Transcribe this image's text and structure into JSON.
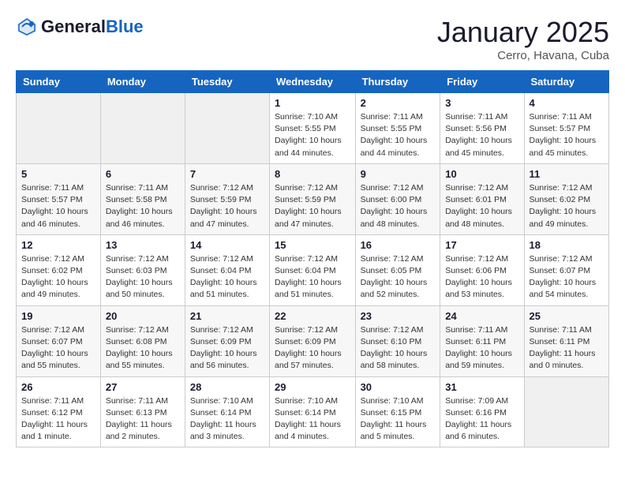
{
  "header": {
    "logo_line1": "General",
    "logo_line2": "Blue",
    "month_title": "January 2025",
    "location": "Cerro, Havana, Cuba"
  },
  "days_of_week": [
    "Sunday",
    "Monday",
    "Tuesday",
    "Wednesday",
    "Thursday",
    "Friday",
    "Saturday"
  ],
  "weeks": [
    [
      {
        "num": "",
        "sunrise": "",
        "sunset": "",
        "daylight": ""
      },
      {
        "num": "",
        "sunrise": "",
        "sunset": "",
        "daylight": ""
      },
      {
        "num": "",
        "sunrise": "",
        "sunset": "",
        "daylight": ""
      },
      {
        "num": "1",
        "sunrise": "Sunrise: 7:10 AM",
        "sunset": "Sunset: 5:55 PM",
        "daylight": "Daylight: 10 hours and 44 minutes."
      },
      {
        "num": "2",
        "sunrise": "Sunrise: 7:11 AM",
        "sunset": "Sunset: 5:55 PM",
        "daylight": "Daylight: 10 hours and 44 minutes."
      },
      {
        "num": "3",
        "sunrise": "Sunrise: 7:11 AM",
        "sunset": "Sunset: 5:56 PM",
        "daylight": "Daylight: 10 hours and 45 minutes."
      },
      {
        "num": "4",
        "sunrise": "Sunrise: 7:11 AM",
        "sunset": "Sunset: 5:57 PM",
        "daylight": "Daylight: 10 hours and 45 minutes."
      }
    ],
    [
      {
        "num": "5",
        "sunrise": "Sunrise: 7:11 AM",
        "sunset": "Sunset: 5:57 PM",
        "daylight": "Daylight: 10 hours and 46 minutes."
      },
      {
        "num": "6",
        "sunrise": "Sunrise: 7:11 AM",
        "sunset": "Sunset: 5:58 PM",
        "daylight": "Daylight: 10 hours and 46 minutes."
      },
      {
        "num": "7",
        "sunrise": "Sunrise: 7:12 AM",
        "sunset": "Sunset: 5:59 PM",
        "daylight": "Daylight: 10 hours and 47 minutes."
      },
      {
        "num": "8",
        "sunrise": "Sunrise: 7:12 AM",
        "sunset": "Sunset: 5:59 PM",
        "daylight": "Daylight: 10 hours and 47 minutes."
      },
      {
        "num": "9",
        "sunrise": "Sunrise: 7:12 AM",
        "sunset": "Sunset: 6:00 PM",
        "daylight": "Daylight: 10 hours and 48 minutes."
      },
      {
        "num": "10",
        "sunrise": "Sunrise: 7:12 AM",
        "sunset": "Sunset: 6:01 PM",
        "daylight": "Daylight: 10 hours and 48 minutes."
      },
      {
        "num": "11",
        "sunrise": "Sunrise: 7:12 AM",
        "sunset": "Sunset: 6:02 PM",
        "daylight": "Daylight: 10 hours and 49 minutes."
      }
    ],
    [
      {
        "num": "12",
        "sunrise": "Sunrise: 7:12 AM",
        "sunset": "Sunset: 6:02 PM",
        "daylight": "Daylight: 10 hours and 49 minutes."
      },
      {
        "num": "13",
        "sunrise": "Sunrise: 7:12 AM",
        "sunset": "Sunset: 6:03 PM",
        "daylight": "Daylight: 10 hours and 50 minutes."
      },
      {
        "num": "14",
        "sunrise": "Sunrise: 7:12 AM",
        "sunset": "Sunset: 6:04 PM",
        "daylight": "Daylight: 10 hours and 51 minutes."
      },
      {
        "num": "15",
        "sunrise": "Sunrise: 7:12 AM",
        "sunset": "Sunset: 6:04 PM",
        "daylight": "Daylight: 10 hours and 51 minutes."
      },
      {
        "num": "16",
        "sunrise": "Sunrise: 7:12 AM",
        "sunset": "Sunset: 6:05 PM",
        "daylight": "Daylight: 10 hours and 52 minutes."
      },
      {
        "num": "17",
        "sunrise": "Sunrise: 7:12 AM",
        "sunset": "Sunset: 6:06 PM",
        "daylight": "Daylight: 10 hours and 53 minutes."
      },
      {
        "num": "18",
        "sunrise": "Sunrise: 7:12 AM",
        "sunset": "Sunset: 6:07 PM",
        "daylight": "Daylight: 10 hours and 54 minutes."
      }
    ],
    [
      {
        "num": "19",
        "sunrise": "Sunrise: 7:12 AM",
        "sunset": "Sunset: 6:07 PM",
        "daylight": "Daylight: 10 hours and 55 minutes."
      },
      {
        "num": "20",
        "sunrise": "Sunrise: 7:12 AM",
        "sunset": "Sunset: 6:08 PM",
        "daylight": "Daylight: 10 hours and 55 minutes."
      },
      {
        "num": "21",
        "sunrise": "Sunrise: 7:12 AM",
        "sunset": "Sunset: 6:09 PM",
        "daylight": "Daylight: 10 hours and 56 minutes."
      },
      {
        "num": "22",
        "sunrise": "Sunrise: 7:12 AM",
        "sunset": "Sunset: 6:09 PM",
        "daylight": "Daylight: 10 hours and 57 minutes."
      },
      {
        "num": "23",
        "sunrise": "Sunrise: 7:12 AM",
        "sunset": "Sunset: 6:10 PM",
        "daylight": "Daylight: 10 hours and 58 minutes."
      },
      {
        "num": "24",
        "sunrise": "Sunrise: 7:11 AM",
        "sunset": "Sunset: 6:11 PM",
        "daylight": "Daylight: 10 hours and 59 minutes."
      },
      {
        "num": "25",
        "sunrise": "Sunrise: 7:11 AM",
        "sunset": "Sunset: 6:11 PM",
        "daylight": "Daylight: 11 hours and 0 minutes."
      }
    ],
    [
      {
        "num": "26",
        "sunrise": "Sunrise: 7:11 AM",
        "sunset": "Sunset: 6:12 PM",
        "daylight": "Daylight: 11 hours and 1 minute."
      },
      {
        "num": "27",
        "sunrise": "Sunrise: 7:11 AM",
        "sunset": "Sunset: 6:13 PM",
        "daylight": "Daylight: 11 hours and 2 minutes."
      },
      {
        "num": "28",
        "sunrise": "Sunrise: 7:10 AM",
        "sunset": "Sunset: 6:14 PM",
        "daylight": "Daylight: 11 hours and 3 minutes."
      },
      {
        "num": "29",
        "sunrise": "Sunrise: 7:10 AM",
        "sunset": "Sunset: 6:14 PM",
        "daylight": "Daylight: 11 hours and 4 minutes."
      },
      {
        "num": "30",
        "sunrise": "Sunrise: 7:10 AM",
        "sunset": "Sunset: 6:15 PM",
        "daylight": "Daylight: 11 hours and 5 minutes."
      },
      {
        "num": "31",
        "sunrise": "Sunrise: 7:09 AM",
        "sunset": "Sunset: 6:16 PM",
        "daylight": "Daylight: 11 hours and 6 minutes."
      },
      {
        "num": "",
        "sunrise": "",
        "sunset": "",
        "daylight": ""
      }
    ]
  ]
}
